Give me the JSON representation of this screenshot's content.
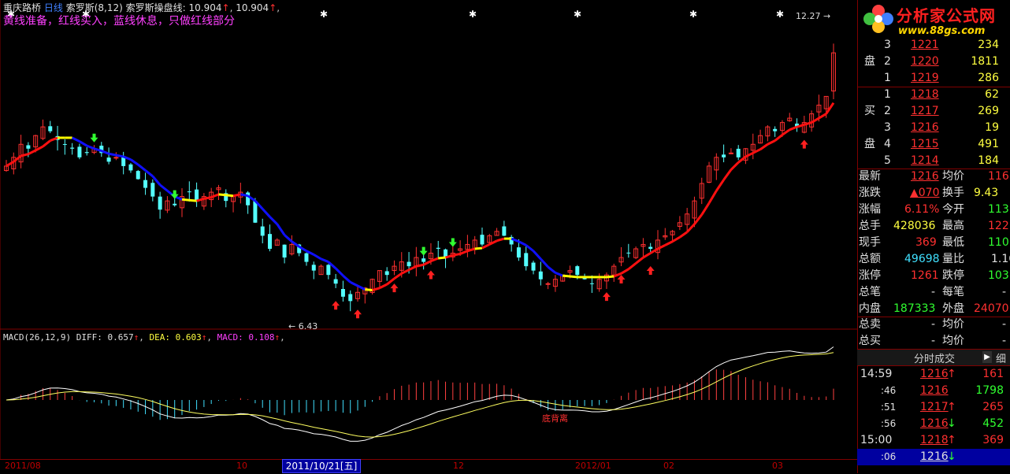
{
  "header": {
    "stock": "重庆路桥",
    "period": "日线",
    "indicator": "索罗斯",
    "indicator_params": "(8,12)",
    "line_label": "索罗斯操盘线:",
    "val1": "10.904",
    "val2": "10.904",
    "hint": "黄线准备，红线买入，蓝线休息，只做红线部分"
  },
  "macd_header": {
    "name": "MACD",
    "params": "(26,12,9)",
    "diff_label": "DIFF:",
    "diff": "0.657",
    "dea_label": "DEA:",
    "dea": "0.603",
    "macd_label": "MACD:",
    "macd": "0.108"
  },
  "chart_labels": {
    "high": "12.27",
    "low": "6.43",
    "divergence": "底背离"
  },
  "date_axis": {
    "ticks": [
      "2011/08",
      "10",
      "12",
      "2012/01",
      "02",
      "03"
    ],
    "cursor": "2011/10/21[五]"
  },
  "logo": {
    "text": "分析家公式网",
    "url": "www.88gs.com"
  },
  "order_book": {
    "sell_label_top": "盘",
    "buy_label_1": "买",
    "buy_label_2": "盘",
    "sell": [
      {
        "level": "3",
        "price": "1221",
        "vol": "234"
      },
      {
        "level": "2",
        "price": "1220",
        "vol": "1811"
      },
      {
        "level": "1",
        "price": "1219",
        "vol": "286"
      }
    ],
    "buy": [
      {
        "level": "1",
        "price": "1218",
        "vol": "62"
      },
      {
        "level": "2",
        "price": "1217",
        "vol": "269"
      },
      {
        "level": "3",
        "price": "1216",
        "vol": "19"
      },
      {
        "level": "4",
        "price": "1215",
        "vol": "491"
      },
      {
        "level": "5",
        "price": "1214",
        "vol": "184"
      }
    ]
  },
  "quote": [
    {
      "l1": "最新",
      "v1": "1216",
      "l2": "均价",
      "v2": "116"
    },
    {
      "l1": "涨跌",
      "v1": "▲070",
      "l2": "换手",
      "v2": "9.43"
    },
    {
      "l1": "涨幅",
      "v1": "6.11%",
      "l2": "今开",
      "v2": "113"
    },
    {
      "l1": "总手",
      "v1": "428036",
      "l2": "最高",
      "v2": "122"
    },
    {
      "l1": "现手",
      "v1": "369",
      "l2": "最低",
      "v2": "110"
    },
    {
      "l1": "总额",
      "v1": "49698",
      "l2": "量比",
      "v2": "1.16"
    },
    {
      "l1": "涨停",
      "v1": "1261",
      "l2": "跌停",
      "v2": "103"
    },
    {
      "l1": "总笔",
      "v1": "-",
      "l2": "每笔",
      "v2": "-"
    },
    {
      "l1": "内盘",
      "v1": "187333",
      "l2": "外盘",
      "v2": "24070"
    },
    {
      "l1": "总卖",
      "v1": "-",
      "l2": "均价",
      "v2": "-"
    },
    {
      "l1": "总买",
      "v1": "-",
      "l2": "均价",
      "v2": "-"
    }
  ],
  "ticks_tab": {
    "label": "分时成交",
    "more": "细"
  },
  "trades": [
    {
      "time": "14:59",
      "price": "1216",
      "dir": "",
      "vol": "161"
    },
    {
      "time": ":46",
      "price": "1216",
      "dir": "",
      "vol": "1798"
    },
    {
      "time": ":51",
      "price": "1217",
      "dir": "up",
      "vol": "265"
    },
    {
      "time": ":56",
      "price": "1216",
      "dir": "down",
      "vol": "452"
    },
    {
      "time": "15:00",
      "price": "1218",
      "dir": "up",
      "vol": "369"
    },
    {
      "time": ":06",
      "price": "1216",
      "dir": "down",
      "vol": ""
    }
  ],
  "chart_data": {
    "type": "candlestick",
    "ylim": [
      6.0,
      12.6
    ],
    "closes": [
      9.6,
      9.8,
      10.1,
      10.0,
      10.3,
      10.5,
      10.4,
      10.2,
      10.1,
      10.0,
      9.8,
      9.9,
      10.0,
      9.9,
      9.7,
      9.8,
      9.6,
      9.5,
      9.3,
      9.1,
      8.9,
      8.6,
      8.8,
      8.7,
      8.9,
      9.0,
      8.8,
      8.9,
      9.0,
      9.1,
      8.8,
      8.9,
      9.0,
      8.7,
      8.3,
      8.0,
      7.7,
      7.9,
      7.5,
      7.8,
      7.6,
      7.4,
      7.2,
      7.3,
      7.1,
      6.9,
      6.6,
      6.5,
      6.7,
      6.8,
      7.0,
      7.2,
      7.1,
      7.3,
      7.4,
      7.3,
      7.5,
      7.4,
      7.6,
      7.7,
      7.5,
      7.6,
      7.7,
      7.8,
      7.9,
      7.8,
      8.0,
      8.1,
      8.0,
      7.8,
      7.5,
      7.3,
      7.2,
      7.0,
      6.9,
      7.0,
      7.1,
      7.2,
      7.1,
      7.0,
      6.9,
      7.0,
      7.1,
      7.3,
      7.5,
      7.6,
      7.7,
      7.8,
      7.7,
      7.9,
      8.0,
      8.1,
      8.3,
      8.5,
      8.8,
      9.2,
      9.6,
      9.8,
      9.8,
      9.9,
      9.8,
      10.0,
      10.1,
      10.3,
      10.5,
      10.4,
      10.6,
      10.7,
      10.5,
      10.6,
      10.8,
      11.0,
      11.2,
      12.2
    ]
  }
}
